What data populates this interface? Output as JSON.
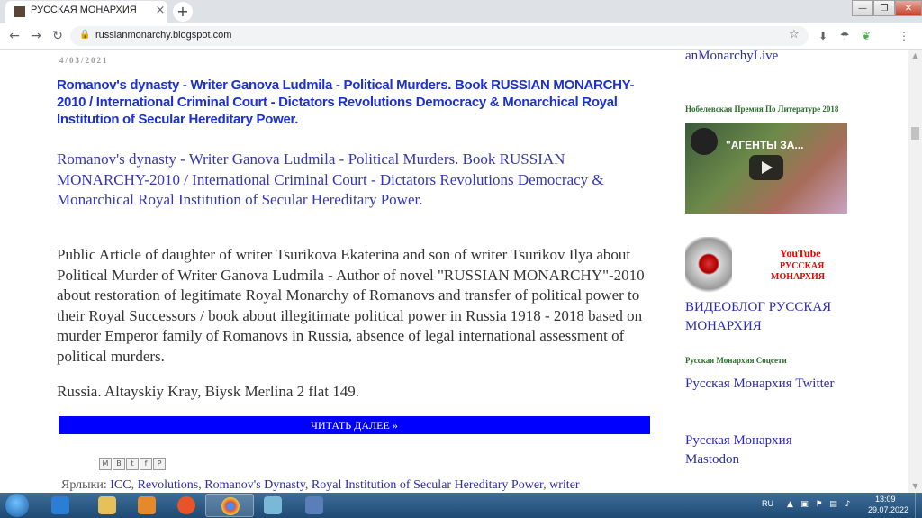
{
  "browser": {
    "tab_title": "РУССКАЯ МОНАРХИЯ",
    "tab_close": "×",
    "new_tab": "+",
    "url": "russianmonarchy.blogspot.com",
    "nav": {
      "back": "←",
      "forward": "→",
      "reload": "↻"
    },
    "window": {
      "minimize": "—",
      "restore": "❐",
      "close": "✕"
    }
  },
  "post": {
    "date": "4/03/2021",
    "title": "Romanov's dynasty - Writer Ganova Ludmila - Political Murders. Book RUSSIAN MONARCHY-2010 / International Criminal Court - Dictators Revolutions Democracy & Monarchical Royal Institution of Secular Hereditary Power.",
    "subtitle": "Romanov's dynasty - Writer Ganova Ludmila - Political Murders. Book RUSSIAN MONARCHY-2010 / International Criminal Court - Dictators Revolutions Democracy & Monarchical Royal Institution of Secular Hereditary Power.",
    "para1": "Public Article of daughter of writer Tsurikova Ekaterina and son of writer Tsurikov Ilya about Political Murder of Writer Ganova Ludmila - Author of novel \"RUSSIAN MONARCHY\"-2010 about restoration of legitimate Royal Monarchy of Romanovs and transfer of political power to their Royal Successors / book about illegitimate political power in Russia 1918 - 2018 based on murder Emperor family of Romanovs in Russia, absence of legal international assessment of political murders.",
    "para2": "Russia. Altayskiy Kray, Biysk Merlina 2 flat 149.",
    "read_more": "ЧИТАТЬ ДАЛЕЕ »",
    "labels_prefix": "Ярлыки:",
    "labels": [
      "ICC",
      "Revolutions",
      "Romanov's Dynasty",
      "Royal Institution of Secular Hereditary Power",
      "writer"
    ],
    "share": [
      "M",
      "B",
      "t",
      "f",
      "P"
    ]
  },
  "sidebar": {
    "live_link": "anMonarchyLive",
    "nobel_heading": "Нобелевская Премия По Литературе 2018",
    "video_title": "\"АГЕНТЫ ЗА...",
    "yt_word": "YouTube",
    "yt_line2": "РУССКАЯ",
    "yt_line3": "МОНАРХИЯ",
    "vlog_link": "ВИДЕОБЛОГ РУССКАЯ МОНАРХИЯ",
    "social_heading": "Русская Монархия Соцсети",
    "twitter_link": "Русская Монархия Twitter",
    "mastodon_link": "Русская Монархия Mastodon"
  },
  "taskbar": {
    "lang": "RU",
    "time": "13:09",
    "date": "29.07.2022"
  },
  "colors": {
    "title_blue": "#1c31d4",
    "link_blue": "#2b2bb0",
    "readmore_bg": "#0000ff",
    "heading_green": "#2a6b2a"
  }
}
